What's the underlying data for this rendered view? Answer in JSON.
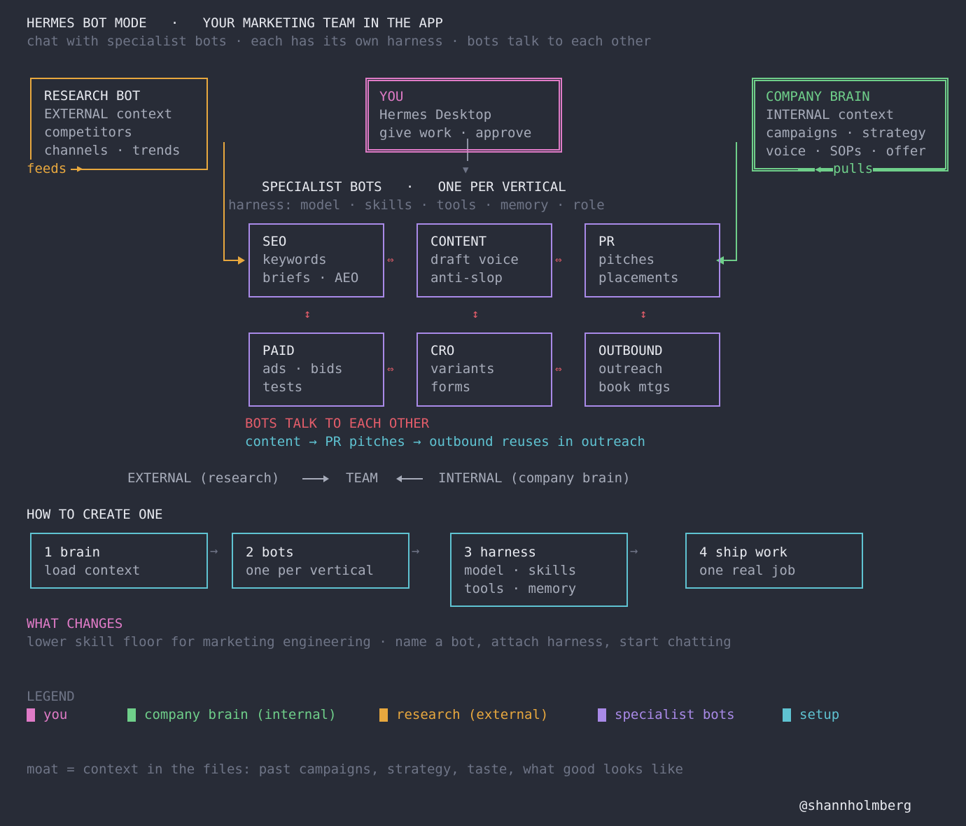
{
  "header": {
    "title": "HERMES BOT MODE   ·   YOUR MARKETING TEAM IN THE APP",
    "subtitle": "chat with specialist bots · each has its own harness · bots talk to each other"
  },
  "research": {
    "title": "RESEARCH BOT",
    "lines": [
      "EXTERNAL context",
      "competitors",
      "channels · trends"
    ],
    "feeds_label": "feeds",
    "feeds_arrow": "▶"
  },
  "you": {
    "title": "YOU",
    "lines": [
      "Hermes Desktop",
      "give work · approve"
    ]
  },
  "company": {
    "title": "COMPANY BRAIN",
    "lines": [
      "INTERNAL context",
      "campaigns · strategy",
      "voice · SOPs · offer"
    ],
    "pulls_label": "pulls",
    "pulls_arrow": "◀"
  },
  "specialists": {
    "title": "SPECIALIST BOTS   ·   ONE PER VERTICAL",
    "harness": "harness: model · skills · tools · memory · role",
    "bots": [
      {
        "title": "SEO",
        "lines": [
          "keywords",
          "briefs · AEO"
        ]
      },
      {
        "title": "CONTENT",
        "lines": [
          "draft voice",
          "anti-slop"
        ]
      },
      {
        "title": "PR",
        "lines": [
          "pitches",
          "placements"
        ]
      },
      {
        "title": "PAID",
        "lines": [
          "ads · bids",
          "tests"
        ]
      },
      {
        "title": "CRO",
        "lines": [
          "variants",
          "forms"
        ]
      },
      {
        "title": "OUTBOUND",
        "lines": [
          "outreach",
          "book mtgs"
        ]
      }
    ],
    "h_connector": "⇔",
    "v_connector": "↕",
    "down_arrow": "▼"
  },
  "talk": {
    "title": "BOTS TALK TO EACH OTHER",
    "line": "content → PR pitches → outbound reuses in outreach"
  },
  "flow": {
    "external": "EXTERNAL (research)",
    "team": "TEAM",
    "internal": "INTERNAL (company brain)"
  },
  "howto": {
    "title": "HOW TO CREATE ONE",
    "steps": [
      {
        "title": "1 brain",
        "lines": [
          "load context"
        ]
      },
      {
        "title": "2 bots",
        "lines": [
          "one per vertical"
        ]
      },
      {
        "title": "3 harness",
        "lines": [
          "model · skills",
          "tools · memory"
        ]
      },
      {
        "title": "4 ship work",
        "lines": [
          "one real job"
        ]
      }
    ],
    "step_arrow": "→"
  },
  "changes": {
    "title": "WHAT CHANGES",
    "line": "lower skill floor for marketing engineering · name a bot, attach harness, start chatting"
  },
  "legend": {
    "title": "LEGEND",
    "items": [
      {
        "label": "you",
        "color": "#e07bc7"
      },
      {
        "label": "company brain (internal)",
        "color": "#6fcf8a"
      },
      {
        "label": "research (external)",
        "color": "#e8a83e"
      },
      {
        "label": "specialist bots",
        "color": "#a98ae8"
      },
      {
        "label": "setup",
        "color": "#5fc3d2"
      }
    ]
  },
  "moat": "moat = context in the files: past campaigns, strategy, taste, what good looks like",
  "handle": "@shannholmberg"
}
